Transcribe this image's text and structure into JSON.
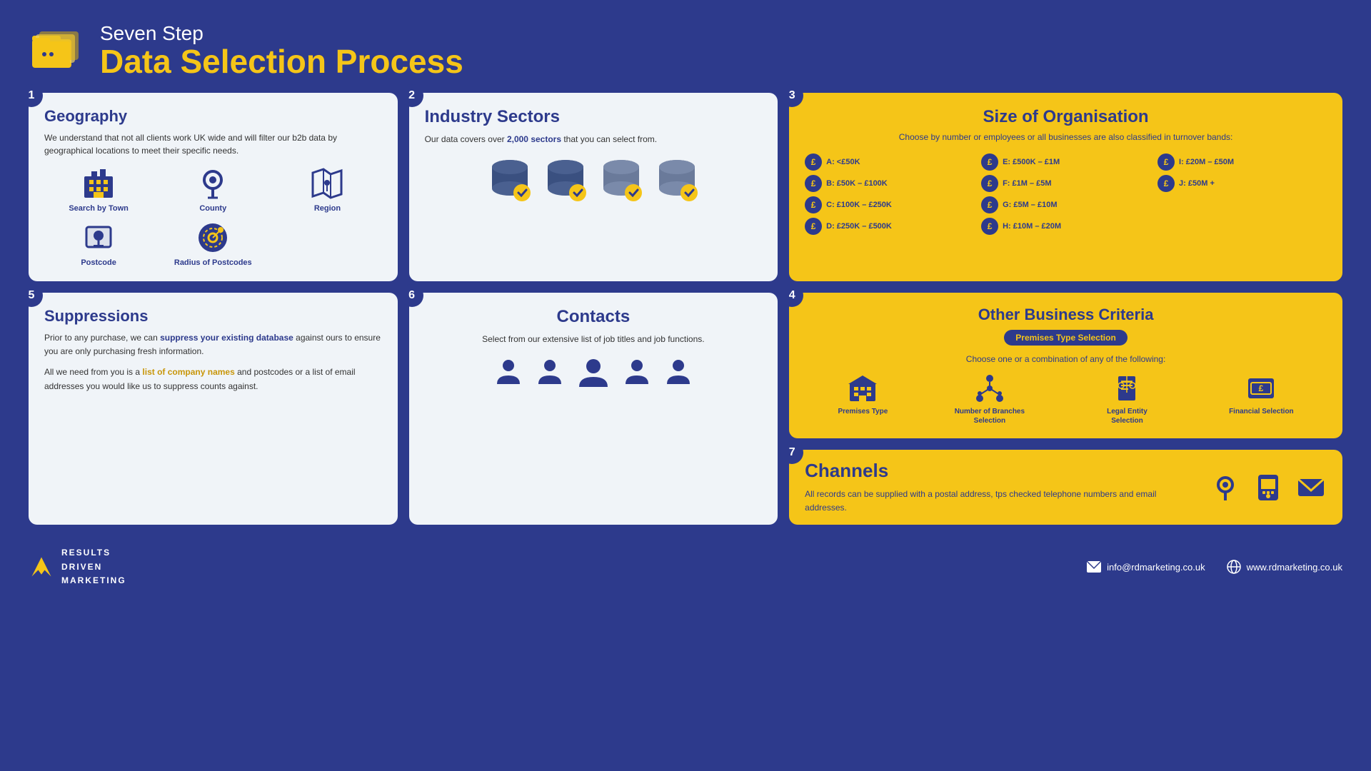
{
  "header": {
    "subtitle": "Seven Step",
    "title": "Data Selection Process"
  },
  "step1": {
    "step_number": "1",
    "title": "Geography",
    "description": "We understand that not all clients work UK wide and will filter our b2b data by geographical locations to meet their specific needs.",
    "items": [
      {
        "label": "Search by Town",
        "icon": "building"
      },
      {
        "label": "County",
        "icon": "map-pin"
      },
      {
        "label": "Region",
        "icon": "map"
      },
      {
        "label": "Postcode",
        "icon": "postcode"
      },
      {
        "label": "Radius of Postcodes",
        "icon": "radius"
      }
    ]
  },
  "step2": {
    "step_number": "2",
    "title": "Industry Sectors",
    "description": "Our data covers over 2,000 sectors that you can select from.",
    "bold_text": "2,000"
  },
  "step3": {
    "step_number": "3",
    "title": "Size of Organisation",
    "subtitle": "Choose by number or employees or all businesses are also classified in turnover bands:",
    "bands": [
      {
        "label": "A: <£50K"
      },
      {
        "label": "E: £500K – £1M"
      },
      {
        "label": "I: £20M – £50M"
      },
      {
        "label": "B: £50K – £100K"
      },
      {
        "label": "F: £1M – £5M"
      },
      {
        "label": "J: £50M +"
      },
      {
        "label": "C: £100K – £250K"
      },
      {
        "label": "G: £5M – £10M"
      },
      {
        "label": ""
      },
      {
        "label": "D: £250K – £500K"
      },
      {
        "label": "H: £10M – £20M"
      },
      {
        "label": ""
      }
    ]
  },
  "step4": {
    "step_number": "4",
    "title": "Other Business Criteria",
    "badge": "Premises Type Selection",
    "subtitle": "Choose one or a combination of any of the following:",
    "items": [
      {
        "label": "Premises Type"
      },
      {
        "label": "Number of Branches Selection"
      },
      {
        "label": "Legal Entity Selection"
      },
      {
        "label": "Financial Selection"
      }
    ]
  },
  "step5": {
    "step_number": "5",
    "title": "Suppressions",
    "para1": "Prior to any purchase, we can suppress your existing database against ours to ensure you are only purchasing fresh information.",
    "para2_start": "All we need from you is a ",
    "para2_link": "list of company names",
    "para2_end": " and postcodes or a list of email addresses you would like us to suppress counts against."
  },
  "step6": {
    "step_number": "6",
    "title": "Contacts",
    "description": "Select from our extensive list of job titles and job functions."
  },
  "step7": {
    "step_number": "7",
    "title": "Channels",
    "description": "All records can be supplied with a postal address, tps checked telephone numbers and email addresses."
  },
  "footer": {
    "logo_line1": "RESULTS",
    "logo_line2": "DRIVEN",
    "logo_line3": "MARKETING",
    "email": "info@rdmarketing.co.uk",
    "website": "www.rdmarketing.co.uk"
  }
}
